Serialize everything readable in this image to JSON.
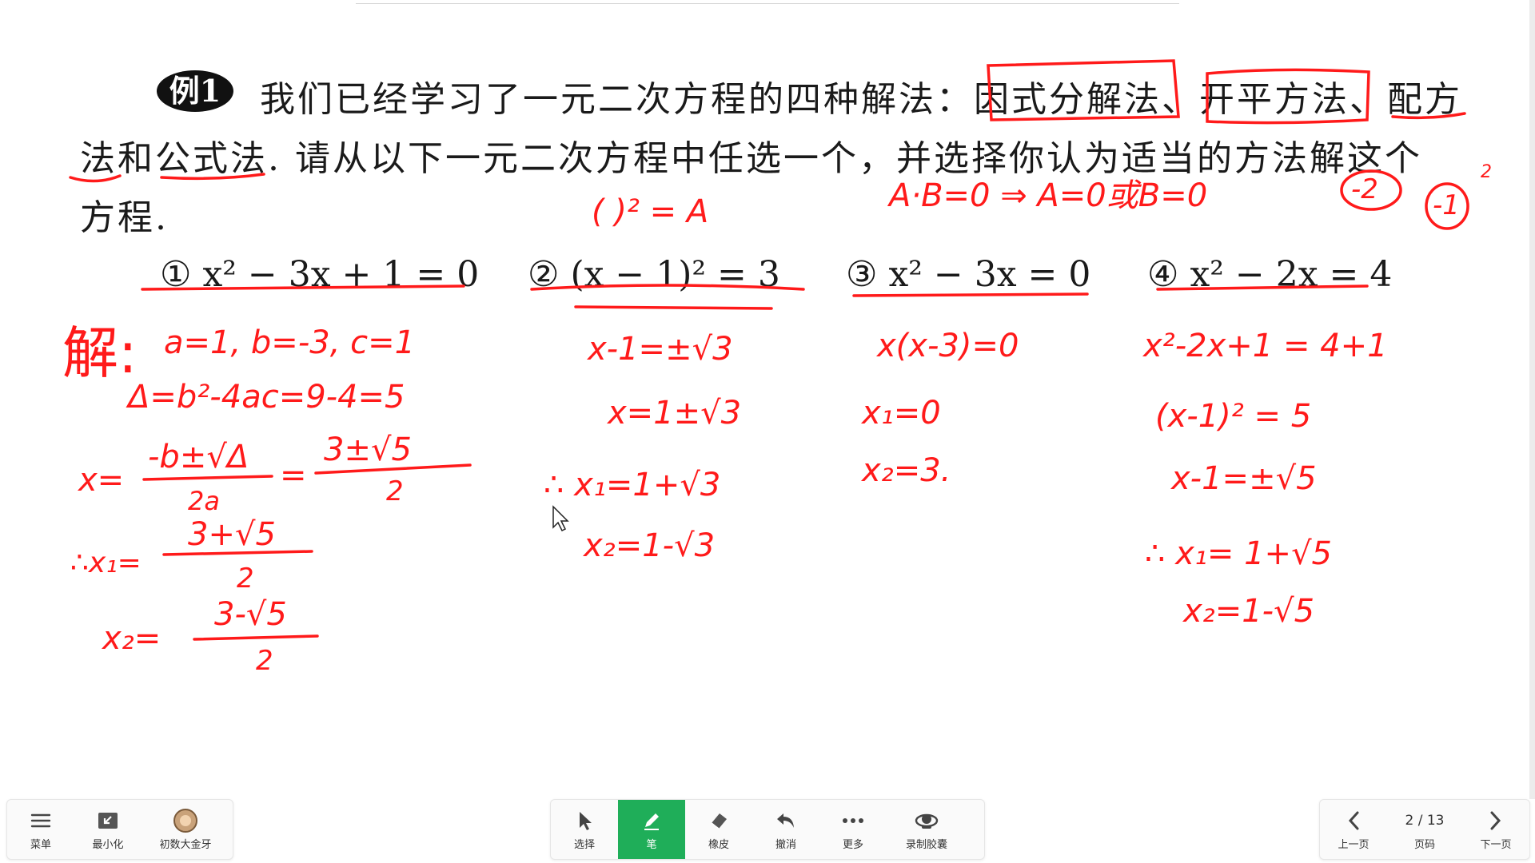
{
  "problem": {
    "badge": "例1",
    "line1_prefix": "我们已经学习了一元二次方程的四种解法：",
    "method1": "因式分解法",
    "sep1": "、",
    "method2": "开平方法",
    "sep2": "、",
    "method3_a": "配方",
    "line2_method3_b": "法",
    "line2_and": "和",
    "method4": "公式法",
    "line2_rest": ". 请从以下一元二次方程中任选一个，并选择你认为适当的方法解这个",
    "line3": "方程."
  },
  "equations": [
    {
      "num": "①",
      "text": "x² − 3x + 1 = 0"
    },
    {
      "num": "②",
      "text": "(x − 1)² = 3"
    },
    {
      "num": "③",
      "text": "x² − 3x = 0"
    },
    {
      "num": "④",
      "text": "x² − 2x = 4"
    }
  ],
  "annotations": {
    "square_form": "(    )² = A",
    "factor_rule": "A·B=0 ⇒ A=0或B=0",
    "circled_minus2": "-2",
    "circled_minus1": "-1",
    "sq_mark": "2",
    "jie": "解:",
    "sol1": [
      "a=1, b=-3, c=1",
      "Δ=b²-4ac=9-4=5",
      "x=",
      "-b±√Δ",
      "2a",
      "=",
      "3±√5",
      "2",
      "∴x₁=",
      "3+√5",
      "2",
      "x₂=",
      "3-√5",
      "2"
    ],
    "sol2": [
      "x-1=±√3",
      "x=1±√3",
      "∴ x₁=1+√3",
      "x₂=1-√3"
    ],
    "sol3": [
      "x(x-3)=0",
      "x₁=0",
      "x₂=3."
    ],
    "sol4": [
      "x²-2x+1 = 4+1",
      "(x-1)² = 5",
      "x-1=±√5",
      "∴ x₁= 1+√5",
      "x₂=1-√5"
    ]
  },
  "toolbar": {
    "left": [
      {
        "label": "菜单",
        "icon": "menu-icon"
      },
      {
        "label": "最小化",
        "icon": "minimize-icon"
      },
      {
        "label": "初数大金牙",
        "icon": "avatar"
      }
    ],
    "center": [
      {
        "label": "选择",
        "icon": "cursor-icon"
      },
      {
        "label": "笔",
        "icon": "pen-icon"
      },
      {
        "label": "橡皮",
        "icon": "eraser-icon"
      },
      {
        "label": "撤消",
        "icon": "undo-icon"
      },
      {
        "label": "更多",
        "icon": "more-icon"
      },
      {
        "label": "录制胶囊",
        "icon": "record-icon"
      }
    ],
    "right": {
      "prev_label": "上一页",
      "page_display": "2 / 13",
      "page_label": "页码",
      "next_label": "下一页"
    }
  },
  "colors": {
    "ink": "#ff1a1a",
    "active": "#1fae59",
    "text": "#1a1a1a"
  }
}
